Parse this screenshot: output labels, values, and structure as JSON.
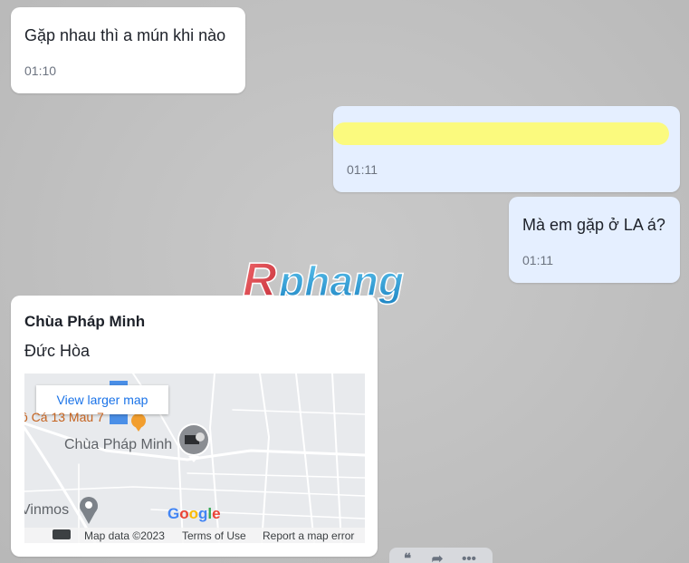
{
  "messages": [
    {
      "direction": "incoming",
      "text": "Gặp nhau thì a mún khi nào",
      "time": "01:10"
    },
    {
      "direction": "outgoing",
      "text": "",
      "time": "01:11"
    },
    {
      "direction": "outgoing",
      "text": "Mà em gặp ở LA á?",
      "time": "01:11"
    }
  ],
  "watermark": "Rphang",
  "location": {
    "title": "Chùa Pháp Minh",
    "subtitle": "Đức Hòa",
    "map": {
      "view_larger": "View larger map",
      "poi_orange": "ô Cá 13 Mau 7",
      "poi_name": "Chùa Pháp Minh",
      "poi_vinmos": "Vinmos",
      "google": "Google",
      "map_data": "Map data ©2023",
      "terms": "Terms of Use",
      "report": "Report a map error"
    }
  },
  "actions": [
    "quote-icon",
    "share-icon",
    "more-icon"
  ],
  "colors": {
    "incoming_bubble": "#ffffff",
    "outgoing_bubble": "#e5efff",
    "highlight": "#fbfa7e",
    "link_blue": "#1a73e8",
    "watermark_red": "#e2454d",
    "watermark_blue": "#3aa5d9"
  }
}
